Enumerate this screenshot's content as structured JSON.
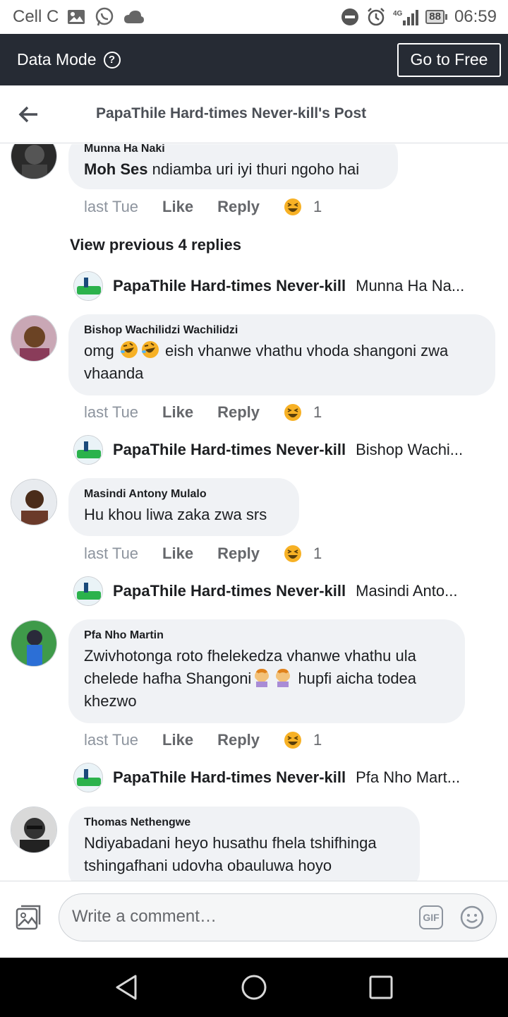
{
  "status_bar": {
    "carrier": "Cell C",
    "network": "4G",
    "battery": "88",
    "time": "06:59"
  },
  "data_bar": {
    "title": "Data Mode",
    "help": "?",
    "button": "Go to Free"
  },
  "header": {
    "title": "PapaThile Hard-times Never-kill's Post"
  },
  "comments": [
    {
      "author": "Munna Ha Naki",
      "mention": "Moh Ses",
      "text": " ndiamba uri iyi thuri ngoho hai",
      "time": "last Tue",
      "like": "Like",
      "reply": "Reply",
      "reactions": "1"
    },
    {
      "author": "Bishop Wachilidzi Wachilidzi",
      "text_before": "omg ",
      "text_after": " eish vhanwe vhathu vhoda shangoni zwa vhaanda",
      "time": "last Tue",
      "like": "Like",
      "reply": "Reply",
      "reactions": "1"
    },
    {
      "author": "Masindi Antony Mulalo",
      "text": "Hu khou liwa zaka zwa srs",
      "time": "last Tue",
      "like": "Like",
      "reply": "Reply",
      "reactions": "1"
    },
    {
      "author": "Pfa Nho Martin",
      "text_before": "Zwivhotonga roto fhelekedza vhanwe vhathu ula chelede hafha Shangoni",
      "text_after": " hupfi aicha todea khezwo",
      "time": "last Tue",
      "like": "Like",
      "reply": "Reply",
      "reactions": "1"
    },
    {
      "author": "Thomas Nethengwe",
      "text": "Ndiyabadani heyo husathu fhela tshifhinga tshingafhani udovha obauluwa hoyo"
    }
  ],
  "view_previous": "View previous 4 replies",
  "replies": [
    {
      "name": "PapaThile Hard-times Never-kill",
      "preview": "Munna Ha Na..."
    },
    {
      "name": "PapaThile Hard-times Never-kill",
      "preview": "Bishop Wachi..."
    },
    {
      "name": "PapaThile Hard-times Never-kill",
      "preview": "Masindi Anto..."
    },
    {
      "name": "PapaThile Hard-times Never-kill",
      "preview": "Pfa Nho Mart..."
    }
  ],
  "composer": {
    "placeholder": "Write a comment…",
    "gif": "GIF"
  },
  "icons": {
    "status": [
      "image-icon",
      "whatsapp-icon",
      "cloud-icon",
      "dnd-icon",
      "alarm-icon",
      "signal-icon",
      "battery-icon"
    ],
    "reaction": "haha-reaction-icon",
    "accent": "#262b34"
  }
}
